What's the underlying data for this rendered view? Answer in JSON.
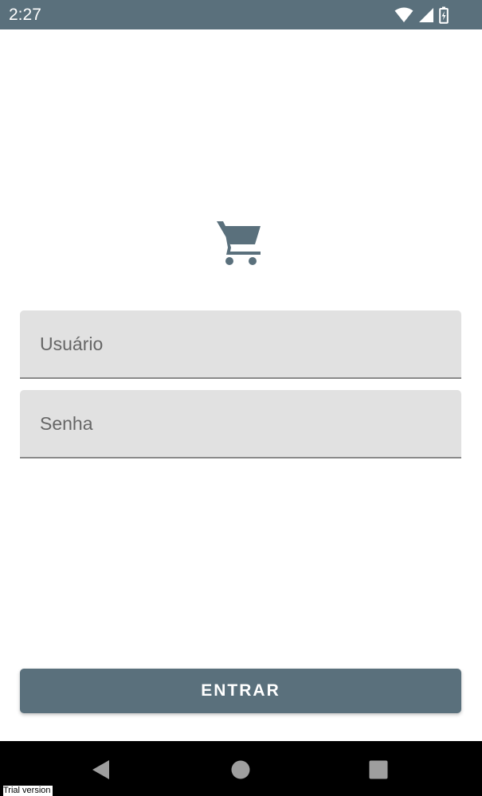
{
  "status_bar": {
    "time": "2:27",
    "background_color": "#5a707c",
    "icons": [
      "wifi-icon",
      "signal-icon",
      "battery-icon"
    ]
  },
  "logo": {
    "icon": "shopping-cart-icon",
    "color": "#5a707c"
  },
  "login_form": {
    "username_placeholder": "Usuário",
    "password_placeholder": "Senha",
    "username_value": "",
    "password_value": "",
    "submit_label": "ENTRAR"
  },
  "nav_bar": {
    "buttons": [
      "back-icon",
      "home-icon",
      "recents-icon"
    ]
  },
  "watermark": {
    "text": "Trial version"
  },
  "colors": {
    "primary": "#5a707c",
    "field_background": "#e1e1e1",
    "field_underline": "#8a8a8a"
  }
}
